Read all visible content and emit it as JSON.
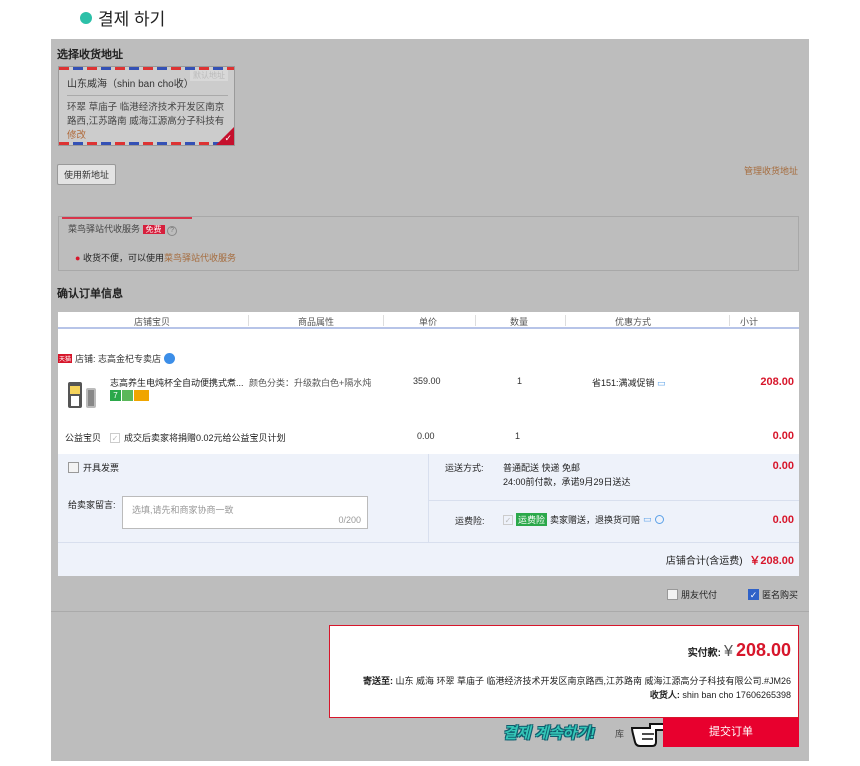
{
  "heading": "결제 하기",
  "address": {
    "section_title": "选择收货地址",
    "name_line": "山东威海（shin ban cho收）",
    "default_tag": "默认地址",
    "detail": "环翠 草庙子 临港经济技术开发区南京路西,江苏路南 威海江源高分子科技有",
    "edit_label": "修改",
    "new_address_button": "使用新地址",
    "manage_link": "管理收货地址"
  },
  "service": {
    "title": "菜鸟驿站代收服务",
    "free_tag": "免费",
    "help_icon": "?",
    "note_prefix": "收货不便，可以使用",
    "note_link": "菜鸟驿站代收服务"
  },
  "order": {
    "section_title": "确认订单信息",
    "columns": [
      "店铺宝贝",
      "商品属性",
      "单价",
      "数量",
      "优惠方式",
      "小计"
    ],
    "store_tag": "天猫",
    "store_label": "店铺: 志高金杞专卖店",
    "product": {
      "name": "志高养生电炖杯全自动便携式煮...",
      "attr": "颜色分类：升级款白色+隔水炖",
      "price": "359.00",
      "qty": "1",
      "discount": "省151:满减促销",
      "subtotal": "208.00",
      "badge_seven": "7"
    },
    "charity": {
      "label": "公益宝贝",
      "text": "成交后卖家将捐赠0.02元给公益宝贝计划",
      "price": "0.00",
      "qty": "1",
      "subtotal": "0.00"
    },
    "invoice_label": "开具发票",
    "message_label": "给卖家留言:",
    "message_placeholder": "选填,请先和商家协商一致",
    "message_count": "0/200",
    "shipping_label": "运送方式:",
    "shipping_line1": "普通配送 快递 免邮",
    "shipping_line2": "24:00前付款，承诺9月29日送达",
    "shipping_fee": "0.00",
    "insurance_label": "运费险:",
    "insurance_tag": "运费险",
    "insurance_text": "卖家赠送，退换货可赔",
    "insurance_fee": "0.00",
    "store_total_label": "店铺合计(含运费)",
    "store_total_value": "￥208.00"
  },
  "options": {
    "friend_pay": "朋友代付",
    "anonymous": "匿名购买"
  },
  "summary": {
    "paid_label": "实付款:",
    "currency": "¥",
    "paid_value": "208.00",
    "ship_to_label": "寄送至:",
    "ship_to": "山东 威海 环翠 草庙子 临港经济技术开发区南京路西,江苏路南 威海江源高分子科技有限公司.#JM26",
    "receiver_label": "收货人:",
    "receiver": "shin ban cho 17606265398"
  },
  "footer": {
    "promo_text": "결제 계속하기!",
    "back_text": "库",
    "submit_label": "提交订单"
  },
  "colors": {
    "accent_red": "#d7162b",
    "submit_red": "#e8002e",
    "teal": "#2cc0a8"
  }
}
